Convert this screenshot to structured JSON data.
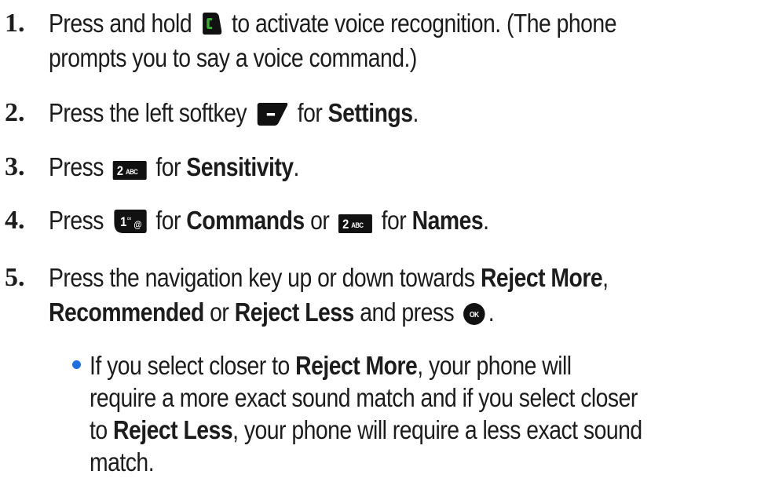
{
  "steps": [
    {
      "number": "1.",
      "line1_a": "Press and hold",
      "line1_b": "to activate voice recognition. (The phone",
      "line2": "prompts you to say a voice command.)",
      "key_icon": "talk-key-icon"
    },
    {
      "number": "2.",
      "a": "Press the left softkey",
      "b": "for",
      "bold": "Settings",
      "end": ".",
      "key_icon": "left-softkey-icon"
    },
    {
      "number": "3.",
      "a": "Press",
      "b": "for",
      "bold": "Sensitivity",
      "end": ".",
      "key_icon": "key-2-abc-icon"
    },
    {
      "number": "4.",
      "a": "Press",
      "b": "for",
      "bold1": "Commands",
      "c": "or",
      "d": "for",
      "bold2": "Names",
      "end": ".",
      "key_icon1": "key-1-voicemail-icon",
      "key_icon2": "key-2-abc-icon"
    },
    {
      "number": "5.",
      "line1_a": "Press the navigation key up or down towards",
      "line1_bold": "Reject More",
      "line1_end": ",",
      "line2_bold1": "Recommended",
      "line2_a": "or",
      "line2_bold2": "Reject Less",
      "line2_b": "and press",
      "line2_end": ".",
      "key_icon": "ok-key-icon"
    }
  ],
  "bullet": {
    "line1_a": "If you select closer to",
    "line1_bold": "Reject More",
    "line1_b": ", your phone will",
    "line2": "require a more exact sound match and if you select closer",
    "line3_a": "to",
    "line3_bold": "Reject Less",
    "line3_b": ", your phone will require a less exact sound",
    "line4": "match."
  },
  "key_labels": {
    "two": "2",
    "abc": "ABC",
    "one": "1",
    "ok": "OK"
  },
  "colors": {
    "text": "#1c1c1c",
    "bullet": "#1f6fe0",
    "talk_green": "#3aa935",
    "key_black": "#111111"
  }
}
